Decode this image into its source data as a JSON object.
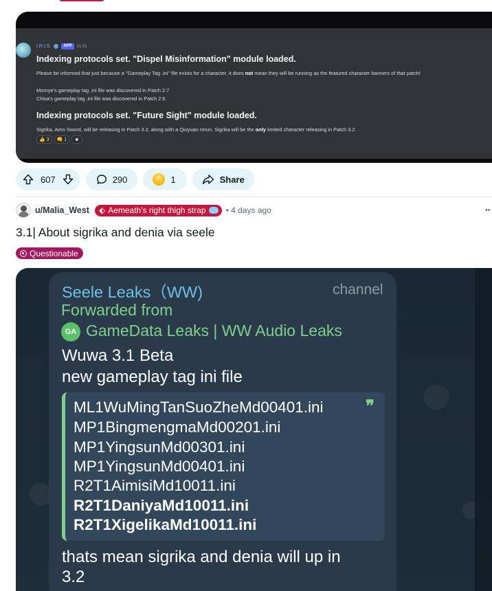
{
  "first_post": {
    "discord": {
      "bot_name": "I.R.I.S.",
      "app_badge": "APP",
      "time": "01:51",
      "heading1": "Indexing protocols set. \"Dispel Misinformation\" module loaded.",
      "para1_pre": "Please be informed that just because a \"Gameplay Tag .ini\" file exists for a character, it does ",
      "para1_bold": "not",
      "para1_post": " mean they will be running as the featured character banners of that patch!",
      "line_mornye": "Mornye's gameplay tag .ini file was discovered in Patch 2.7",
      "line_chisa": "Chisa's gameplay tag .ini file was discovered in Patch 2.6",
      "heading2": "Indexing protocols set. \"Future Sight\" module loaded.",
      "para2_pre": "Sigrika, Aero Sword, will be releasing in Patch 3.2, along with a Qiuyuan rerun. Sigrika will be the ",
      "para2_bold": "only",
      "para2_post": " limited character releasing in Patch 3.2.",
      "reactions": [
        {
          "icon": "thumbs-up-icon",
          "glyph": "👍",
          "count": "3"
        },
        {
          "icon": "fist-bump-icon",
          "glyph": "👊",
          "count": "1"
        },
        {
          "icon": "smiley-icon",
          "glyph": "☻",
          "count": ""
        }
      ]
    },
    "actions": {
      "votes": "607",
      "comments": "290",
      "awards": "1",
      "share": "Share"
    }
  },
  "second_post": {
    "username": "u/Malia_West",
    "user_flair": "Aemeath's right thigh strap",
    "time_ago": "4 days ago",
    "separator": "•",
    "title": "3.1| About sigrika and denia via seele",
    "post_flair": "Questionable",
    "telegram": {
      "channel_name": "Seele Leaks（WW)",
      "channel_tag": "channel",
      "forwarded_label": "Forwarded from",
      "source_badge": "GA",
      "source_name": "GameData Leaks | WW Audio Leaks",
      "line1": "Wuwa 3.1 Beta",
      "line2": "new gameplay tag ini file",
      "quote_mark": "❞",
      "files": [
        "ML1WuMingTanSuoZheMd00401.ini",
        "MP1BingmengmaMd00201.ini",
        "MP1YingsunMd00301.ini",
        "MP1YingsunMd00401.ini",
        "R2T1AimisiMd10011.ini",
        "R2T1DaniyaMd10011.ini",
        "R2T1XigelikaMd10011.ini"
      ],
      "footer_line1": "thats mean sigrika and denia will up in",
      "footer_line2": "3.2"
    }
  }
}
